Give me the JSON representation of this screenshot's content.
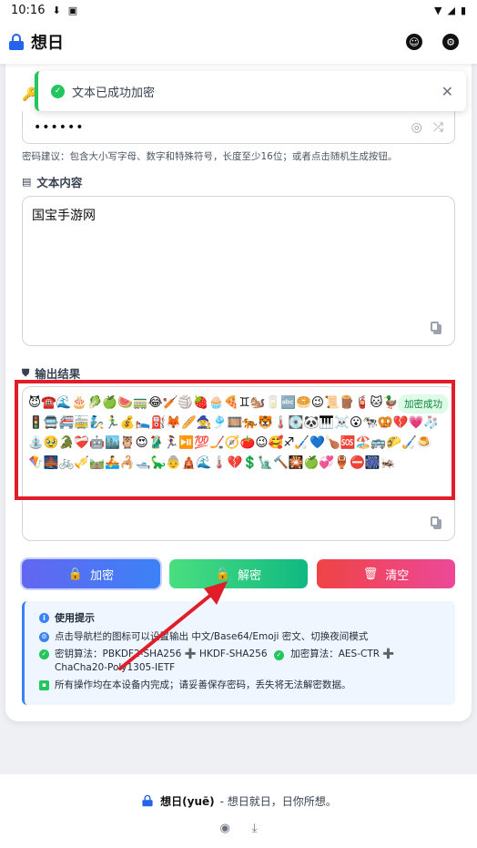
{
  "status_bar": {
    "time": "10:16"
  },
  "app": {
    "title": "想日"
  },
  "toast": {
    "message": "文本已成功加密",
    "close": "✕"
  },
  "password": {
    "masked_value": "••••••"
  },
  "password_hint": "密码建议：包含大小写字母、数字和特殊符号，长度至少16位；或者点击随机生成按钮。",
  "text_section": {
    "label": "文本内容",
    "value": "国宝手游网"
  },
  "output_section": {
    "label": "输出结果",
    "value": "😈☎️🌊🎂🥬🍏🍉🚃😂🏏🏐🍓🧁🍕♊🐿️🥛🔤🥯😉📜🪵🧯🐱🦆🍎🐂😤🚦🚍🚝🚋🧞🏃‍♂️💰🛌⛽🦊🥖🧙🎐🎞️🐅🐯🌡️💽🐼🎹☠️😮🐄🥨💔💗🧦⛲🥹🐊❤️‍🩹🤖🏙️🦉😍🥻🏃‍♀️⏯️💯🏒🧭🍅😉🥰♐🏑💙🍗🆘🏖️🚌🌮🏑🍮🪁🌉🚲🎺🛤️🚣🦂🛥️🦕👵🛕🌊🌡️💔💲🗽🔨🎇🍏💞🏺⛔🎆🦗",
    "badge": "加密成功"
  },
  "buttons": {
    "encrypt": "加密",
    "decrypt": "解密",
    "clear": "清空"
  },
  "tips": {
    "title": "使用提示",
    "line1": "点击导航栏的图标可以设置输出 中文/Base64/Emoji 密文、切换夜间模式",
    "line2a": "密钥算法：PBKDF2-SHA256 ➕ HKDF-SHA256",
    "line2b": "加密算法：AES-CTR ➕ ChaCha20-Poly1305-IETF",
    "line3": "所有操作均在本设备内完成；请妥善保存密码，丢失将无法解密数据。"
  },
  "footer": {
    "brand": "想日(yuē)",
    "tagline": " - 想日就日，日你所想。"
  },
  "colors": {
    "accent": "#2563eb",
    "success": "#22c55e",
    "danger": "#ef4444",
    "highlight": "#e11d2a"
  }
}
